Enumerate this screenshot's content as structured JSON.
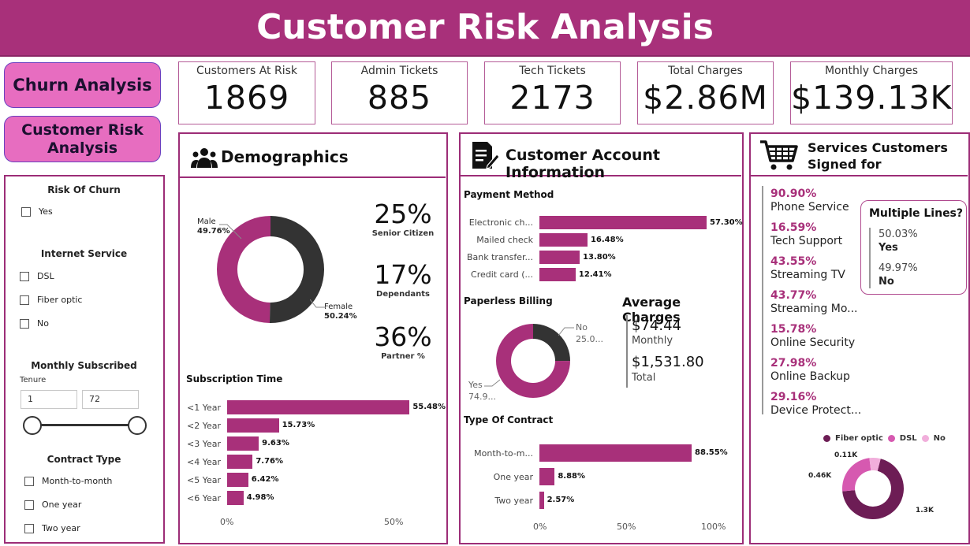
{
  "header": {
    "title": "Customer Risk Analysis"
  },
  "nav": {
    "churn": "Churn Analysis",
    "risk_line1": "Customer Risk",
    "risk_line2": "Analysis"
  },
  "kpis": [
    {
      "label": "Customers At Risk",
      "value": "1869"
    },
    {
      "label": "Admin Tickets",
      "value": "885"
    },
    {
      "label": "Tech Tickets",
      "value": "2173"
    },
    {
      "label": "Total Charges",
      "value": "$2.86M"
    },
    {
      "label": "Monthly Charges",
      "value": "$139.13K"
    }
  ],
  "filters": {
    "risk_title": "Risk Of Churn",
    "risk_opts": [
      "Yes"
    ],
    "internet_title": "Internet Service",
    "internet_opts": [
      "DSL",
      "Fiber optic",
      "No"
    ],
    "monthly_title": "Monthly Subscribed",
    "tenure_label": "Tenure",
    "tenure_min": "1",
    "tenure_max": "72",
    "contract_title": "Contract Type",
    "contract_opts": [
      "Month-to-month",
      "One year",
      "Two year"
    ]
  },
  "demographics": {
    "title": "Demographics",
    "donut": {
      "male_label": "Male",
      "male_pct": "49.76%",
      "female_label": "Female",
      "female_pct": "50.24%",
      "male_value": 49.76,
      "female_value": 50.24,
      "male_color": "#a8307a",
      "female_color": "#333333"
    },
    "stats": [
      {
        "value": "25%",
        "label": "Senior Citizen"
      },
      {
        "value": "17%",
        "label": "Dependants"
      },
      {
        "value": "36%",
        "label": "Partner %"
      }
    ],
    "subscription_title": "Subscription Time",
    "axis": [
      "0%",
      "50%"
    ]
  },
  "account": {
    "title": "Customer Account Information",
    "payment_title": "Payment Method",
    "paperless_title": "Paperless Billing",
    "paperless": {
      "no_label": "No",
      "no_val": "25.0...",
      "yes_label": "Yes",
      "yes_val": "74.9...",
      "no_value": 25.0,
      "yes_value": 74.9
    },
    "avg_title": "Average Charges",
    "avg_monthly_val": "$74.44",
    "avg_monthly_lbl": "Monthly",
    "avg_total_val": "$1,531.80",
    "avg_total_lbl": "Total",
    "contract_title": "Type Of Contract",
    "axis": [
      "0%",
      "50%",
      "100%"
    ]
  },
  "services": {
    "title_line1": "Services Customers",
    "title_line2": "Signed for",
    "items": [
      {
        "pct": "90.90%",
        "name": "Phone Service"
      },
      {
        "pct": "16.59%",
        "name": "Tech Support"
      },
      {
        "pct": "43.55%",
        "name": "Streaming TV"
      },
      {
        "pct": "43.77%",
        "name": "Streaming Mo..."
      },
      {
        "pct": "15.78%",
        "name": "Online Security"
      },
      {
        "pct": "27.98%",
        "name": "Online Backup"
      },
      {
        "pct": "29.16%",
        "name": "Device Protect..."
      }
    ],
    "multi": {
      "title": "Multiple Lines?",
      "yes_pct": "50.03%",
      "yes": "Yes",
      "no_pct": "49.97%",
      "no": "No"
    },
    "legend": [
      "Fiber optic",
      "DSL",
      "No"
    ],
    "donut_labels": {
      "fiber": "1.3K",
      "dsl": "0.46K",
      "no": "0.11K"
    }
  },
  "chart_data": [
    {
      "type": "bar",
      "title": "Subscription Time",
      "categories": [
        "<1 Year",
        "<2 Year",
        "<3 Year",
        "<4 Year",
        "<5 Year",
        "<6 Year"
      ],
      "values": [
        55.48,
        15.73,
        9.63,
        7.76,
        6.42,
        4.98
      ],
      "labels": [
        "55.48%",
        "15.73%",
        "9.63%",
        "7.76%",
        "6.42%",
        "4.98%"
      ],
      "color": "#a8307a"
    },
    {
      "type": "bar",
      "title": "Payment Method",
      "categories": [
        "Electronic ch...",
        "Mailed check",
        "Bank transfer...",
        "Credit card (..."
      ],
      "values": [
        57.3,
        16.48,
        13.8,
        12.41
      ],
      "labels": [
        "57.30%",
        "16.48%",
        "13.80%",
        "12.41%"
      ],
      "color": "#a8307a"
    },
    {
      "type": "bar",
      "title": "Type Of Contract",
      "categories": [
        "Month-to-m...",
        "One year",
        "Two year"
      ],
      "values": [
        88.55,
        8.88,
        2.57
      ],
      "labels": [
        "88.55%",
        "8.88%",
        "2.57%"
      ],
      "color": "#a8307a"
    },
    {
      "type": "pie",
      "categories": [
        "Fiber optic",
        "DSL",
        "No"
      ],
      "values": [
        1300,
        460,
        110
      ],
      "labels": [
        "1.3K",
        "0.46K",
        "0.11K"
      ],
      "colors": [
        "#6d1d55",
        "#d659b0",
        "#f1aedb"
      ]
    }
  ]
}
